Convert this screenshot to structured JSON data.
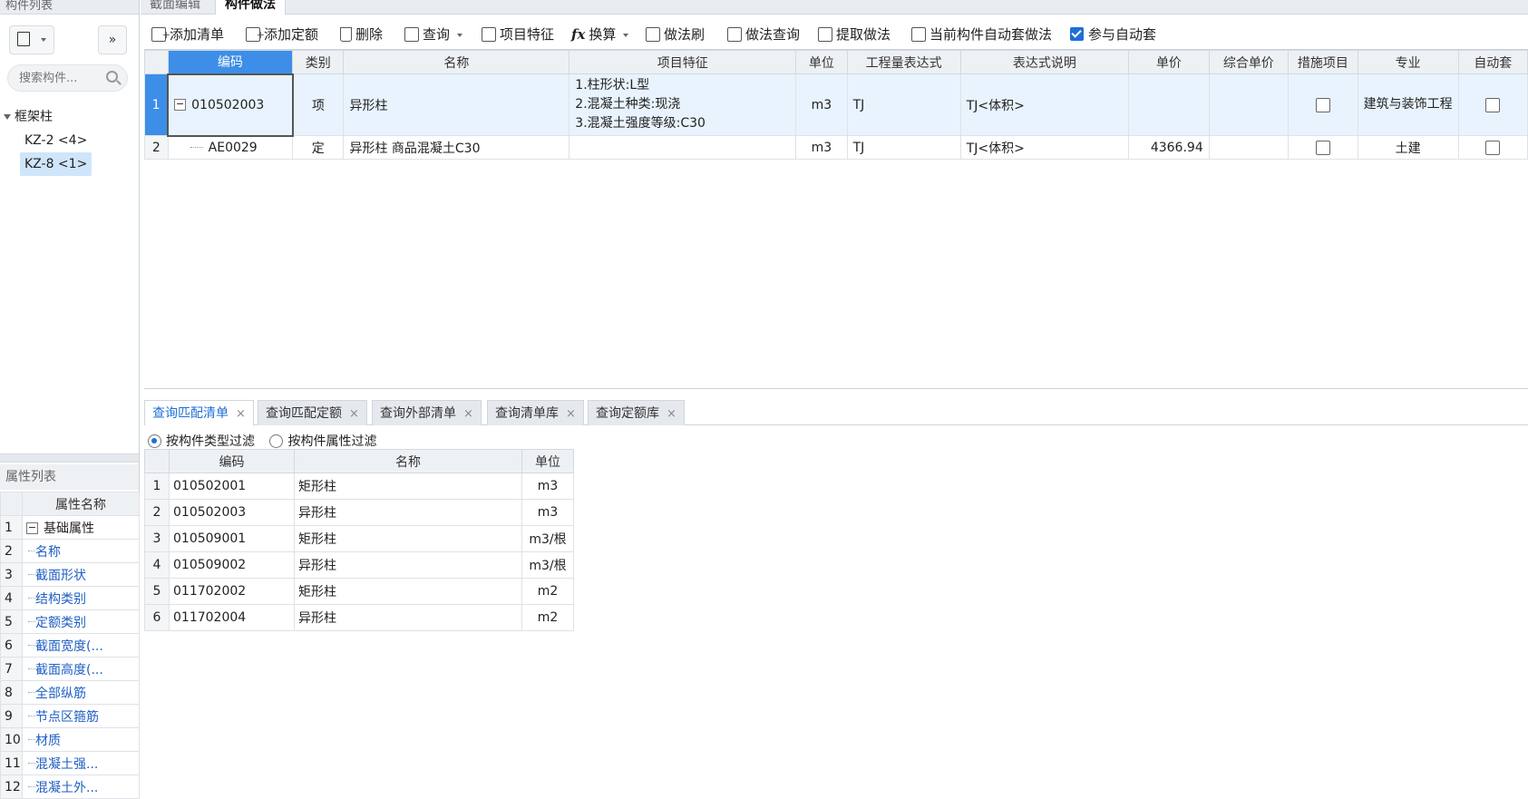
{
  "left": {
    "component_list_title": "构件列表",
    "expand_btn": "»",
    "search_placeholder": "搜索构件...",
    "tree_group": "框架柱",
    "tree_items": [
      "KZ-2 <4>",
      "KZ-8 <1>"
    ],
    "attr_list_title": "属性列表",
    "attr_col_header": "属性名称",
    "attr_rows": [
      {
        "num": "1",
        "label": "基础属性"
      },
      {
        "num": "2",
        "label": "名称"
      },
      {
        "num": "3",
        "label": "截面形状"
      },
      {
        "num": "4",
        "label": "结构类别"
      },
      {
        "num": "5",
        "label": "定额类别"
      },
      {
        "num": "6",
        "label": "截面宽度(..."
      },
      {
        "num": "7",
        "label": "截面高度(..."
      },
      {
        "num": "8",
        "label": "全部纵筋"
      },
      {
        "num": "9",
        "label": "节点区箍筋"
      },
      {
        "num": "10",
        "label": "材质"
      },
      {
        "num": "11",
        "label": "混凝土强..."
      },
      {
        "num": "12",
        "label": "混凝土外..."
      }
    ]
  },
  "top_tabs": [
    "截面编辑",
    "构件做法"
  ],
  "toolbar": {
    "add_list": "添加清单",
    "add_quota": "添加定额",
    "delete": "删除",
    "query": "查询",
    "item_feature": "项目特征",
    "convert": "换算",
    "method_brush": "做法刷",
    "method_query": "做法查询",
    "extract_method": "提取做法",
    "auto_apply": "当前构件自动套做法",
    "join_auto": "参与自动套"
  },
  "grid": {
    "headers": [
      "编码",
      "类别",
      "名称",
      "项目特征",
      "单位",
      "工程量表达式",
      "表达式说明",
      "单价",
      "综合单价",
      "措施项目",
      "专业",
      "自动套"
    ],
    "rows": [
      {
        "num": "1",
        "code": "010502003",
        "type": "项",
        "name": "异形柱",
        "feature_lines": [
          "1.柱形状:L型",
          "2.混凝土种类:现浇",
          "3.混凝土强度等级:C30"
        ],
        "unit": "m3",
        "expr": "TJ",
        "expr_desc": "TJ<体积>",
        "price": "",
        "total_price": "",
        "specialty": "建筑与装饰工程"
      },
      {
        "num": "2",
        "code": "AE0029",
        "type": "定",
        "name": "异形柱 商品混凝土C30",
        "feature_lines": [],
        "unit": "m3",
        "expr": "TJ",
        "expr_desc": "TJ<体积>",
        "price": "4366.94",
        "total_price": "",
        "specialty": "土建"
      }
    ]
  },
  "bottom_tabs": [
    "查询匹配清单",
    "查询匹配定额",
    "查询外部清单",
    "查询清单库",
    "查询定额库"
  ],
  "filters": {
    "by_type": "按构件类型过滤",
    "by_attr": "按构件属性过滤"
  },
  "match_table": {
    "headers": [
      "编码",
      "名称",
      "单位"
    ],
    "rows": [
      {
        "num": "1",
        "code": "010502001",
        "name": "矩形柱",
        "unit": "m3"
      },
      {
        "num": "2",
        "code": "010502003",
        "name": "异形柱",
        "unit": "m3"
      },
      {
        "num": "3",
        "code": "010509001",
        "name": "矩形柱",
        "unit": "m3/根"
      },
      {
        "num": "4",
        "code": "010509002",
        "name": "异形柱",
        "unit": "m3/根"
      },
      {
        "num": "5",
        "code": "011702002",
        "name": "矩形柱",
        "unit": "m2"
      },
      {
        "num": "6",
        "code": "011702004",
        "name": "异形柱",
        "unit": "m2"
      }
    ]
  },
  "colors": {
    "accent": "#3d8ee8",
    "selected_row": "#e8f3fd",
    "link_blue": "#1f5fc4"
  }
}
